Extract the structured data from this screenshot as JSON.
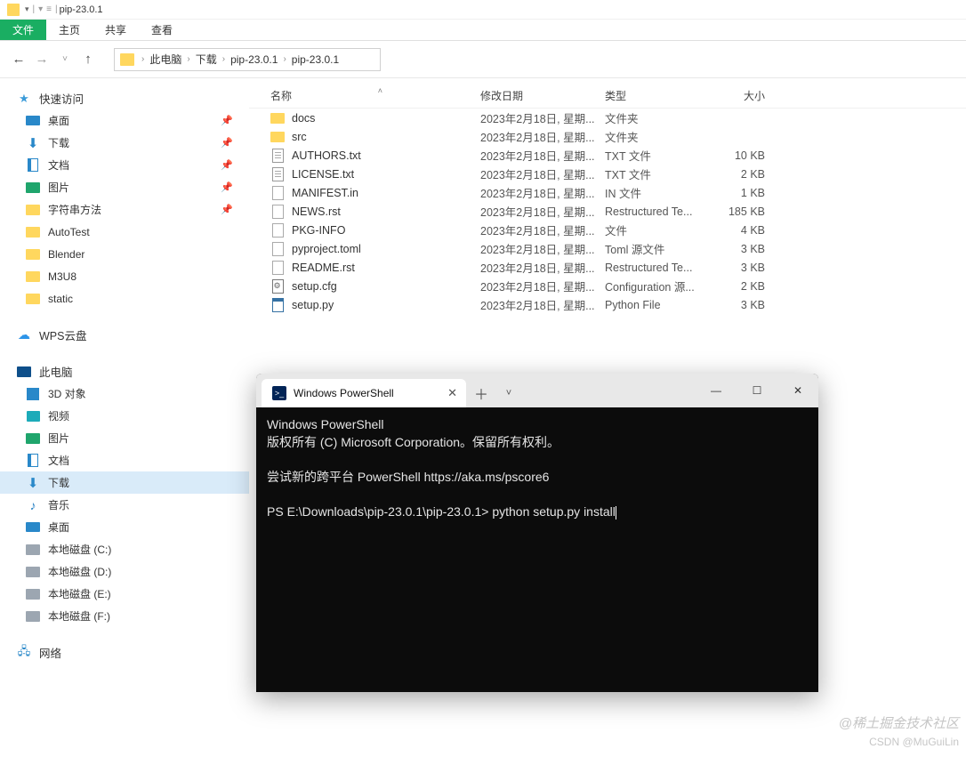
{
  "title_bar": {
    "name": "pip-23.0.1"
  },
  "menu": [
    "文件",
    "主页",
    "共享",
    "查看"
  ],
  "breadcrumb": [
    "此电脑",
    "下载",
    "pip-23.0.1",
    "pip-23.0.1"
  ],
  "sidebar": {
    "quick_access": {
      "label": "快速访问",
      "items": [
        {
          "label": "桌面",
          "icon": "desktop",
          "pinned": true
        },
        {
          "label": "下载",
          "icon": "down",
          "pinned": true
        },
        {
          "label": "文档",
          "icon": "doc",
          "pinned": true
        },
        {
          "label": "图片",
          "icon": "pic",
          "pinned": true
        },
        {
          "label": "字符串方法",
          "icon": "folder",
          "pinned": true
        },
        {
          "label": "AutoTest",
          "icon": "folder"
        },
        {
          "label": "Blender",
          "icon": "folder"
        },
        {
          "label": "M3U8",
          "icon": "folder"
        },
        {
          "label": "static",
          "icon": "folder"
        }
      ]
    },
    "wps": {
      "label": "WPS云盘"
    },
    "this_pc": {
      "label": "此电脑",
      "items": [
        {
          "label": "3D 对象",
          "icon": "3d"
        },
        {
          "label": "视频",
          "icon": "video"
        },
        {
          "label": "图片",
          "icon": "pic"
        },
        {
          "label": "文档",
          "icon": "doc"
        },
        {
          "label": "下载",
          "icon": "down",
          "selected": true
        },
        {
          "label": "音乐",
          "icon": "music"
        },
        {
          "label": "桌面",
          "icon": "desktop"
        },
        {
          "label": "本地磁盘 (C:)",
          "icon": "drive"
        },
        {
          "label": "本地磁盘 (D:)",
          "icon": "drive"
        },
        {
          "label": "本地磁盘 (E:)",
          "icon": "drive"
        },
        {
          "label": "本地磁盘 (F:)",
          "icon": "drive"
        }
      ]
    },
    "network": {
      "label": "网络"
    }
  },
  "columns": {
    "name": "名称",
    "date": "修改日期",
    "type": "类型",
    "size": "大小"
  },
  "files": [
    {
      "name": "docs",
      "date": "2023年2月18日, 星期...",
      "type": "文件夹",
      "size": "",
      "icon": "folder"
    },
    {
      "name": "src",
      "date": "2023年2月18日, 星期...",
      "type": "文件夹",
      "size": "",
      "icon": "folder"
    },
    {
      "name": "AUTHORS.txt",
      "date": "2023年2月18日, 星期...",
      "type": "TXT 文件",
      "size": "10 KB",
      "icon": "txt"
    },
    {
      "name": "LICENSE.txt",
      "date": "2023年2月18日, 星期...",
      "type": "TXT 文件",
      "size": "2 KB",
      "icon": "txt"
    },
    {
      "name": "MANIFEST.in",
      "date": "2023年2月18日, 星期...",
      "type": "IN 文件",
      "size": "1 KB",
      "icon": "generic"
    },
    {
      "name": "NEWS.rst",
      "date": "2023年2月18日, 星期...",
      "type": "Restructured Te...",
      "size": "185 KB",
      "icon": "generic"
    },
    {
      "name": "PKG-INFO",
      "date": "2023年2月18日, 星期...",
      "type": "文件",
      "size": "4 KB",
      "icon": "generic"
    },
    {
      "name": "pyproject.toml",
      "date": "2023年2月18日, 星期...",
      "type": "Toml 源文件",
      "size": "3 KB",
      "icon": "generic"
    },
    {
      "name": "README.rst",
      "date": "2023年2月18日, 星期...",
      "type": "Restructured Te...",
      "size": "3 KB",
      "icon": "generic"
    },
    {
      "name": "setup.cfg",
      "date": "2023年2月18日, 星期...",
      "type": "Configuration 源...",
      "size": "2 KB",
      "icon": "cfg"
    },
    {
      "name": "setup.py",
      "date": "2023年2月18日, 星期...",
      "type": "Python File",
      "size": "3 KB",
      "icon": "py"
    }
  ],
  "terminal": {
    "tab_title": "Windows PowerShell",
    "lines": [
      "Windows PowerShell",
      "版权所有 (C) Microsoft Corporation。保留所有权利。",
      "",
      "尝试新的跨平台 PowerShell https://aka.ms/pscore6",
      ""
    ],
    "prompt_path": "PS E:\\Downloads\\pip-23.0.1\\pip-23.0.1>",
    "command": "python setup.py install"
  },
  "watermark1": "@稀土掘金技术社区",
  "watermark2": "CSDN @MuGuiLin"
}
